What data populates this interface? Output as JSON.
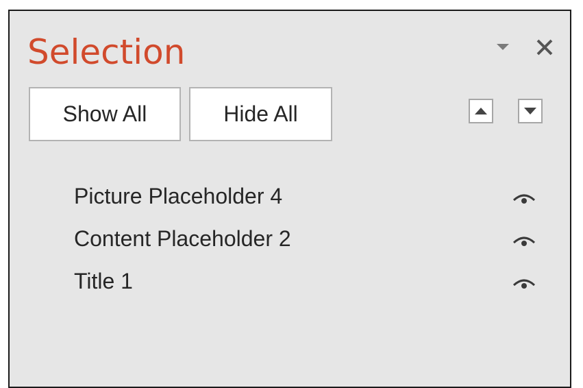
{
  "pane": {
    "title": "Selection",
    "options_icon": "dropdown-triangle-icon",
    "close_icon": "close-icon"
  },
  "toolbar": {
    "show_all_label": "Show All",
    "hide_all_label": "Hide All",
    "bring_forward_icon": "triangle-up-icon",
    "send_backward_icon": "triangle-down-icon"
  },
  "items": [
    {
      "label": "Picture Placeholder 4",
      "visible": true,
      "icon": "eye-icon"
    },
    {
      "label": "Content Placeholder 2",
      "visible": true,
      "icon": "eye-icon"
    },
    {
      "label": "Title 1",
      "visible": true,
      "icon": "eye-icon"
    }
  ],
  "colors": {
    "title": "#d14a2c",
    "pane_background": "#e6e6e6",
    "text": "#262626"
  }
}
